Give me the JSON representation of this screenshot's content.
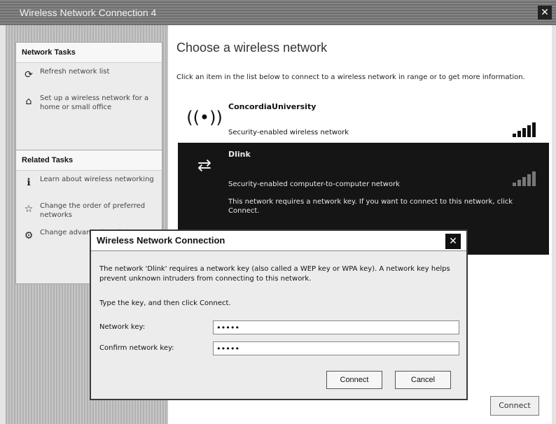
{
  "window": {
    "title": "Wireless Network Connection 4",
    "close_glyph": "✕"
  },
  "network_tasks": {
    "header": "Network Tasks",
    "items": [
      {
        "icon": "refresh-icon",
        "glyph": "⟳",
        "label": "Refresh network list"
      },
      {
        "icon": "setup-network-icon",
        "glyph": "⌂",
        "label": "Set up a wireless network for a home or small office"
      }
    ]
  },
  "related_tasks": {
    "header": "Related Tasks",
    "items": [
      {
        "icon": "learn-icon",
        "glyph": "ℹ",
        "label": "Learn about wireless networking"
      },
      {
        "icon": "star-icon",
        "glyph": "☆",
        "label": "Change the order of preferred networks"
      },
      {
        "icon": "settings-icon",
        "glyph": "⚙",
        "label": "Change advanced settings"
      }
    ]
  },
  "content": {
    "title": "Choose a wireless network",
    "description": "Click an item in the list below to connect to a wireless network in range or to get more information."
  },
  "networks": [
    {
      "name": "ConcordiaUniversity",
      "security": "Security-enabled wireless network",
      "icon": "wireless-antenna-icon",
      "glyph": "((•))",
      "signal": 1.0,
      "selected": false
    },
    {
      "name": "Dlink",
      "security": "Security-enabled computer-to-computer network",
      "icon": "computer-to-computer-icon",
      "glyph": "⇄",
      "signal": 0.6,
      "selected": true,
      "info": "This network requires a network key. If you want to connect to this network, click Connect."
    }
  ],
  "main_connect_label": "Connect",
  "dialog": {
    "title": "Wireless Network Connection",
    "close_glyph": "✕",
    "message": "The network 'Dlink' requires a network key (also called a WEP key or WPA key). A network key helps prevent unknown intruders from connecting to this network.",
    "instruction": "Type the key, and then click Connect.",
    "network_key_label": "Network key:",
    "network_key_value": "•••••",
    "confirm_key_label": "Confirm network key:",
    "confirm_key_value": "•••••",
    "connect_label": "Connect",
    "cancel_label": "Cancel"
  }
}
